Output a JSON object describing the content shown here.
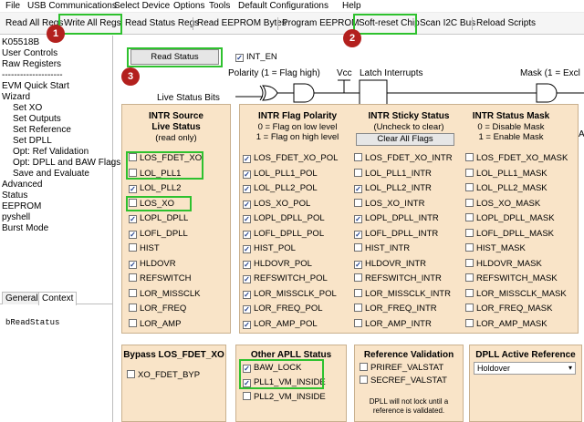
{
  "menubar": [
    "File",
    "USB Communications",
    "Select Device",
    "Options",
    "Tools",
    "Default Configurations",
    "Help"
  ],
  "toolbar": [
    "Read All Regs",
    "Write All Regs",
    "Read Status Regs",
    "Read EEPROM Bytes",
    "Program EEPROM",
    "Soft-reset Chip",
    "Scan I2C Bus",
    "Reload Scripts"
  ],
  "sidebar": {
    "items": [
      "K05518B",
      "User Controls",
      "Raw Registers",
      "--------------------",
      "EVM Quick Start",
      "Wizard",
      "Set XO",
      "Set Outputs",
      "Set Reference",
      "Set DPLL",
      "Opt: Ref Validation",
      "Opt: DPLL and BAW Flags",
      "Save and Evaluate",
      "Advanced",
      "Status",
      "EEPROM",
      "pyshell",
      "Burst Mode"
    ],
    "tabs": [
      "General",
      "Context"
    ],
    "context_text": "bReadStatus"
  },
  "badges": [
    "1",
    "2",
    "3"
  ],
  "main": {
    "read_status_label": "Read Status",
    "int_en_label": "INT_EN",
    "polarity_note": "Polarity (1 = Flag high)",
    "vcc_label": "Vcc",
    "latch_label": "Latch Interrupts",
    "mask_note": "Mask (1 = Excl",
    "live_status_bits": "Live Status Bits",
    "cut_letter": "A"
  },
  "intr_source": {
    "title1": "INTR Source",
    "title2": "Live Status",
    "sub": "(read only)",
    "items": [
      {
        "label": "LOS_FDET_XO",
        "checked": false
      },
      {
        "label": "LOL_PLL1",
        "checked": false
      },
      {
        "label": "LOL_PLL2",
        "checked": true
      },
      {
        "label": "LOS_XO",
        "checked": false
      },
      {
        "label": "LOPL_DPLL",
        "checked": true
      },
      {
        "label": "LOFL_DPLL",
        "checked": true
      },
      {
        "label": "HIST",
        "checked": false
      },
      {
        "label": "HLDOVR",
        "checked": true
      },
      {
        "label": "REFSWITCH",
        "checked": false
      },
      {
        "label": "LOR_MISSCLK",
        "checked": false
      },
      {
        "label": "LOR_FREQ",
        "checked": false
      },
      {
        "label": "LOR_AMP",
        "checked": false
      }
    ]
  },
  "polarity": {
    "title": "INTR Flag Polarity",
    "sub1": "0 = Flag on low level",
    "sub2": "1 = Flag on high level",
    "items": [
      {
        "label": "LOS_FDET_XO_POL",
        "checked": true
      },
      {
        "label": "LOL_PLL1_POL",
        "checked": true
      },
      {
        "label": "LOL_PLL2_POL",
        "checked": true
      },
      {
        "label": "LOS_XO_POL",
        "checked": true
      },
      {
        "label": "LOPL_DPLL_POL",
        "checked": true
      },
      {
        "label": "LOFL_DPLL_POL",
        "checked": true
      },
      {
        "label": "HIST_POL",
        "checked": true
      },
      {
        "label": "HLDOVR_POL",
        "checked": true
      },
      {
        "label": "REFSWITCH_POL",
        "checked": true
      },
      {
        "label": "LOR_MISSCLK_POL",
        "checked": true
      },
      {
        "label": "LOR_FREQ_POL",
        "checked": true
      },
      {
        "label": "LOR_AMP_POL",
        "checked": true
      }
    ]
  },
  "sticky": {
    "title": "INTR Sticky Status",
    "sub": "(Uncheck to clear)",
    "clear_label": "Clear All Flags",
    "items": [
      {
        "label": "LOS_FDET_XO_INTR",
        "checked": false
      },
      {
        "label": "LOL_PLL1_INTR",
        "checked": false
      },
      {
        "label": "LOL_PLL2_INTR",
        "checked": true
      },
      {
        "label": "LOS_XO_INTR",
        "checked": false
      },
      {
        "label": "LOPL_DPLL_INTR",
        "checked": true
      },
      {
        "label": "LOFL_DPLL_INTR",
        "checked": true
      },
      {
        "label": "HIST_INTR",
        "checked": false
      },
      {
        "label": "HLDOVR_INTR",
        "checked": true
      },
      {
        "label": "REFSWITCH_INTR",
        "checked": false
      },
      {
        "label": "LOR_MISSCLK_INTR",
        "checked": false
      },
      {
        "label": "LOR_FREQ_INTR",
        "checked": false
      },
      {
        "label": "LOR_AMP_INTR",
        "checked": false
      }
    ]
  },
  "mask": {
    "title": "INTR Status Mask",
    "sub1": "0 = Disable Mask",
    "sub2": "1 = Enable Mask",
    "items": [
      {
        "label": "LOS_FDET_XO_MASK",
        "checked": false
      },
      {
        "label": "LOL_PLL1_MASK",
        "checked": false
      },
      {
        "label": "LOL_PLL2_MASK",
        "checked": false
      },
      {
        "label": "LOS_XO_MASK",
        "checked": false
      },
      {
        "label": "LOPL_DPLL_MASK",
        "checked": false
      },
      {
        "label": "LOFL_DPLL_MASK",
        "checked": false
      },
      {
        "label": "HIST_MASK",
        "checked": false
      },
      {
        "label": "HLDOVR_MASK",
        "checked": false
      },
      {
        "label": "REFSWITCH_MASK",
        "checked": false
      },
      {
        "label": "LOR_MISSCLK_MASK",
        "checked": false
      },
      {
        "label": "LOR_FREQ_MASK",
        "checked": false
      },
      {
        "label": "LOR_AMP_MASK",
        "checked": false
      }
    ]
  },
  "bypass": {
    "title": "Bypass LOS_FDET_XO",
    "items": [
      {
        "label": "XO_FDET_BYP",
        "checked": false
      }
    ]
  },
  "apll": {
    "title": "Other APLL Status",
    "items": [
      {
        "label": "BAW_LOCK",
        "checked": true
      },
      {
        "label": "PLL1_VM_INSIDE",
        "checked": true
      },
      {
        "label": "PLL2_VM_INSIDE",
        "checked": false
      }
    ]
  },
  "refval": {
    "title": "Reference Validation",
    "items": [
      {
        "label": "PRIREF_VALSTAT",
        "checked": false
      },
      {
        "label": "SECREF_VALSTAT",
        "checked": false
      }
    ],
    "note1": "DPLL will not lock until a",
    "note2": "reference is validated."
  },
  "dpll_ref": {
    "title": "DPLL Active Reference",
    "value": "Holdover"
  },
  "colors": {
    "panel": "#f9e4c8",
    "highlight": "#2ec12e",
    "badge": "#b3201e"
  }
}
